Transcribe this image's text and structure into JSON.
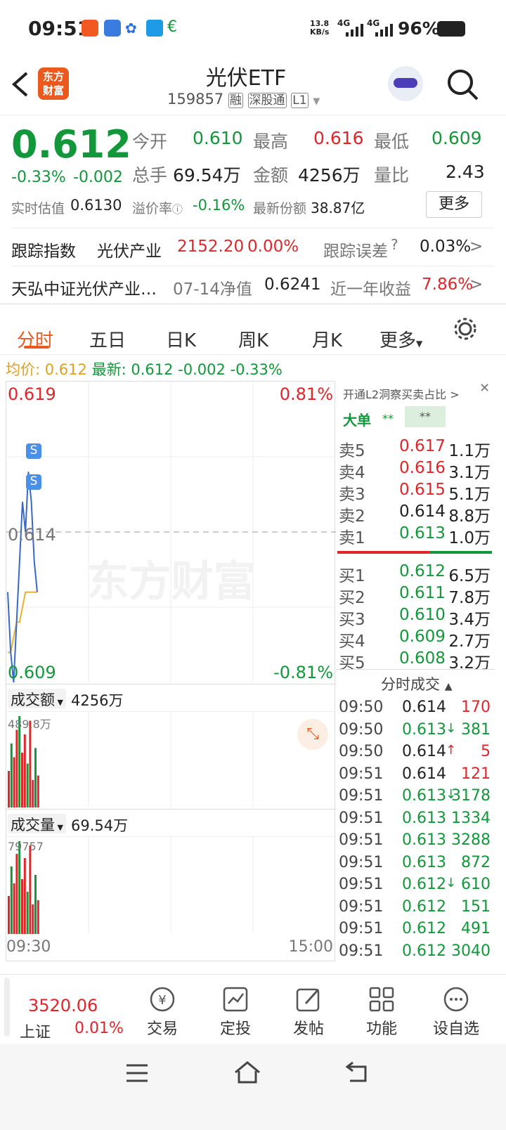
{
  "status": {
    "time": "09:51",
    "speed": "13.8",
    "speed_unit": "KB/s",
    "net1": "4G",
    "net2": "4G",
    "battery": "96%"
  },
  "header": {
    "title": "光伏ETF",
    "code": "159857",
    "tag1": "融",
    "tag2": "深股通",
    "tag3": "L1",
    "logo_line1": "东方",
    "logo_line2": "财富"
  },
  "quote": {
    "price": "0.612",
    "pct": "-0.33%",
    "chg": "-0.002",
    "open_label": "今开",
    "open": "0.610",
    "high_label": "最高",
    "high": "0.616",
    "low_label": "最低",
    "low": "0.609",
    "vol_label": "总手",
    "vol": "69.54万",
    "amt_label": "金额",
    "amt": "4256万",
    "ratio_label": "量比",
    "ratio": "2.43",
    "est_label": "实时估值",
    "est": "0.6130",
    "premium_label": "溢价率",
    "premium": "-0.16%",
    "shares_label": "最新份额",
    "shares": "38.87亿",
    "more": "更多"
  },
  "track": {
    "label": "跟踪指数",
    "index": "光伏产业",
    "value": "2152.20",
    "pct": "0.00%",
    "err_label": "跟踪误差",
    "err": "0.03%",
    "fund": "天弘中证光伏产业…",
    "nav_date": "07-14净值",
    "nav": "0.6241",
    "year_label": "近一年收益",
    "year": "7.86%"
  },
  "tabs": [
    "分时",
    "五日",
    "日K",
    "周K",
    "月K",
    "更多"
  ],
  "avgbar": {
    "avg_label": "均价:",
    "avg": "0.612",
    "last_label": "最新:",
    "last": "0.612",
    "chg": "-0.002",
    "pct": "-0.33%"
  },
  "chart": {
    "top_price": "0.619",
    "top_pct": "0.81%",
    "mid_price": "0.614",
    "bot_price": "0.609",
    "bot_pct": "-0.81%",
    "amt_label": "成交额",
    "amt": "4256万",
    "amt_max": "489.8万",
    "vol_label": "成交量",
    "vol": "69.54万",
    "vol_max": "79757",
    "t_start": "09:30",
    "t_end": "15:00",
    "watermark": "东方财富"
  },
  "chart_data": {
    "type": "line",
    "x_range": [
      "09:30",
      "15:00"
    ],
    "ylim": [
      0.609,
      0.619
    ],
    "prev_close": 0.614,
    "price": [
      0.612,
      0.61,
      0.609,
      0.611,
      0.613,
      0.615,
      0.614,
      0.616,
      0.615,
      0.613,
      0.612
    ],
    "avg": [
      0.61,
      0.61,
      0.6105,
      0.611,
      0.611,
      0.6115,
      0.612,
      0.612,
      0.612,
      0.612,
      0.612
    ]
  },
  "l2": {
    "title": "开通L2洞察买卖占比",
    "big": "大单",
    "stars1": "**",
    "stars2": "**"
  },
  "sell": [
    {
      "l": "卖5",
      "p": "0.617",
      "v": "1.1万"
    },
    {
      "l": "卖4",
      "p": "0.616",
      "v": "3.1万"
    },
    {
      "l": "卖3",
      "p": "0.615",
      "v": "5.1万"
    },
    {
      "l": "卖2",
      "p": "0.614",
      "v": "8.8万"
    },
    {
      "l": "卖1",
      "p": "0.613",
      "v": "1.0万"
    }
  ],
  "buy": [
    {
      "l": "买1",
      "p": "0.612",
      "v": "6.5万"
    },
    {
      "l": "买2",
      "p": "0.611",
      "v": "7.8万"
    },
    {
      "l": "买3",
      "p": "0.610",
      "v": "3.4万"
    },
    {
      "l": "买4",
      "p": "0.609",
      "v": "2.7万"
    },
    {
      "l": "买5",
      "p": "0.608",
      "v": "3.2万"
    }
  ],
  "ticks_title": "分时成交",
  "ticks": [
    {
      "t": "09:50",
      "p": "0.614",
      "d": "",
      "v": "170"
    },
    {
      "t": "09:50",
      "p": "0.613",
      "d": "↓",
      "v": "381"
    },
    {
      "t": "09:50",
      "p": "0.614",
      "d": "↑",
      "v": "5"
    },
    {
      "t": "09:51",
      "p": "0.614",
      "d": "",
      "v": "121"
    },
    {
      "t": "09:51",
      "p": "0.613",
      "d": "↓",
      "v": "3178"
    },
    {
      "t": "09:51",
      "p": "0.613",
      "d": "",
      "v": "1334"
    },
    {
      "t": "09:51",
      "p": "0.613",
      "d": "",
      "v": "3288"
    },
    {
      "t": "09:51",
      "p": "0.613",
      "d": "",
      "v": "872"
    },
    {
      "t": "09:51",
      "p": "0.612",
      "d": "↓",
      "v": "610"
    },
    {
      "t": "09:51",
      "p": "0.612",
      "d": "",
      "v": "151"
    },
    {
      "t": "09:51",
      "p": "0.612",
      "d": "",
      "v": "491"
    },
    {
      "t": "09:51",
      "p": "0.612",
      "d": "",
      "v": "3040"
    }
  ],
  "bottom": {
    "index_value": "3520.06",
    "index_name": "上证",
    "index_pct": "0.01%",
    "trade": "交易",
    "plan": "定投",
    "post": "发帖",
    "func": "功能",
    "watch": "设自选"
  }
}
